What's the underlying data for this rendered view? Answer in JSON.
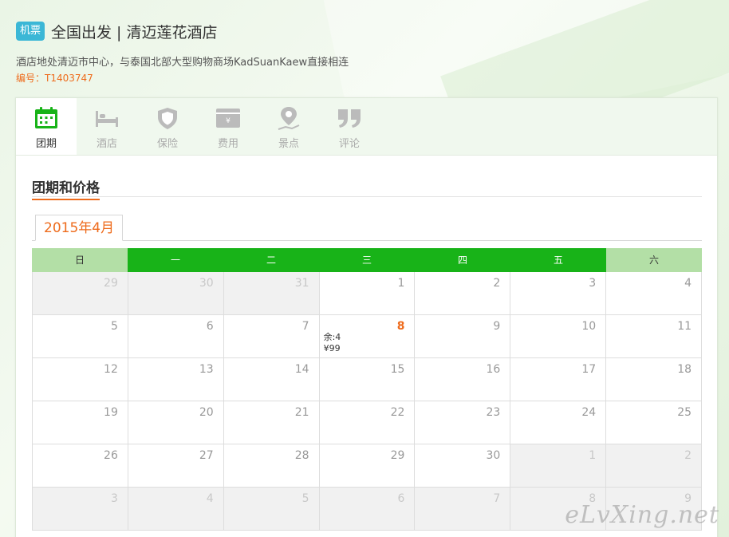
{
  "header": {
    "badge": "机票",
    "title": "全国出发 | 清迈莲花酒店",
    "subtitle": "酒店地处清迈市中心，与泰国北部大型购物商场KadSuanKaew直接相连",
    "code": "编号：T1403747"
  },
  "tabs": [
    {
      "label": "团期",
      "icon": "calendar-icon",
      "active": true
    },
    {
      "label": "酒店",
      "icon": "bed-icon",
      "active": false
    },
    {
      "label": "保险",
      "icon": "shield-icon",
      "active": false
    },
    {
      "label": "费用",
      "icon": "wallet-icon",
      "active": false
    },
    {
      "label": "景点",
      "icon": "map-pin-icon",
      "active": false
    },
    {
      "label": "评论",
      "icon": "quote-icon",
      "active": false
    }
  ],
  "section": {
    "title": "团期和价格"
  },
  "calendar": {
    "month_label": "2015年4月",
    "weekdays": [
      "日",
      "一",
      "二",
      "三",
      "四",
      "五",
      "六"
    ],
    "weeks": [
      [
        {
          "day": "29",
          "other": true
        },
        {
          "day": "30",
          "other": true
        },
        {
          "day": "31",
          "other": true
        },
        {
          "day": "1"
        },
        {
          "day": "2"
        },
        {
          "day": "3"
        },
        {
          "day": "4"
        }
      ],
      [
        {
          "day": "5"
        },
        {
          "day": "6"
        },
        {
          "day": "7"
        },
        {
          "day": "8",
          "avail": true,
          "remain": "余:4",
          "price": "¥99"
        },
        {
          "day": "9"
        },
        {
          "day": "10"
        },
        {
          "day": "11"
        }
      ],
      [
        {
          "day": "12"
        },
        {
          "day": "13"
        },
        {
          "day": "14"
        },
        {
          "day": "15"
        },
        {
          "day": "16"
        },
        {
          "day": "17"
        },
        {
          "day": "18"
        }
      ],
      [
        {
          "day": "19"
        },
        {
          "day": "20"
        },
        {
          "day": "21"
        },
        {
          "day": "22"
        },
        {
          "day": "23"
        },
        {
          "day": "24"
        },
        {
          "day": "25"
        }
      ],
      [
        {
          "day": "26"
        },
        {
          "day": "27"
        },
        {
          "day": "28"
        },
        {
          "day": "29"
        },
        {
          "day": "30"
        },
        {
          "day": "1",
          "other": true
        },
        {
          "day": "2",
          "other": true
        }
      ],
      [
        {
          "day": "3",
          "other": true
        },
        {
          "day": "4",
          "other": true
        },
        {
          "day": "5",
          "other": true
        },
        {
          "day": "6",
          "other": true
        },
        {
          "day": "7",
          "other": true
        },
        {
          "day": "8",
          "other": true
        },
        {
          "day": "9",
          "other": true
        }
      ]
    ]
  },
  "watermark": "eLvXing.net",
  "colors": {
    "accent": "#ee6b1c",
    "green": "#18b318",
    "light_green": "#b3dfa6",
    "badge": "#3bb7d6"
  }
}
